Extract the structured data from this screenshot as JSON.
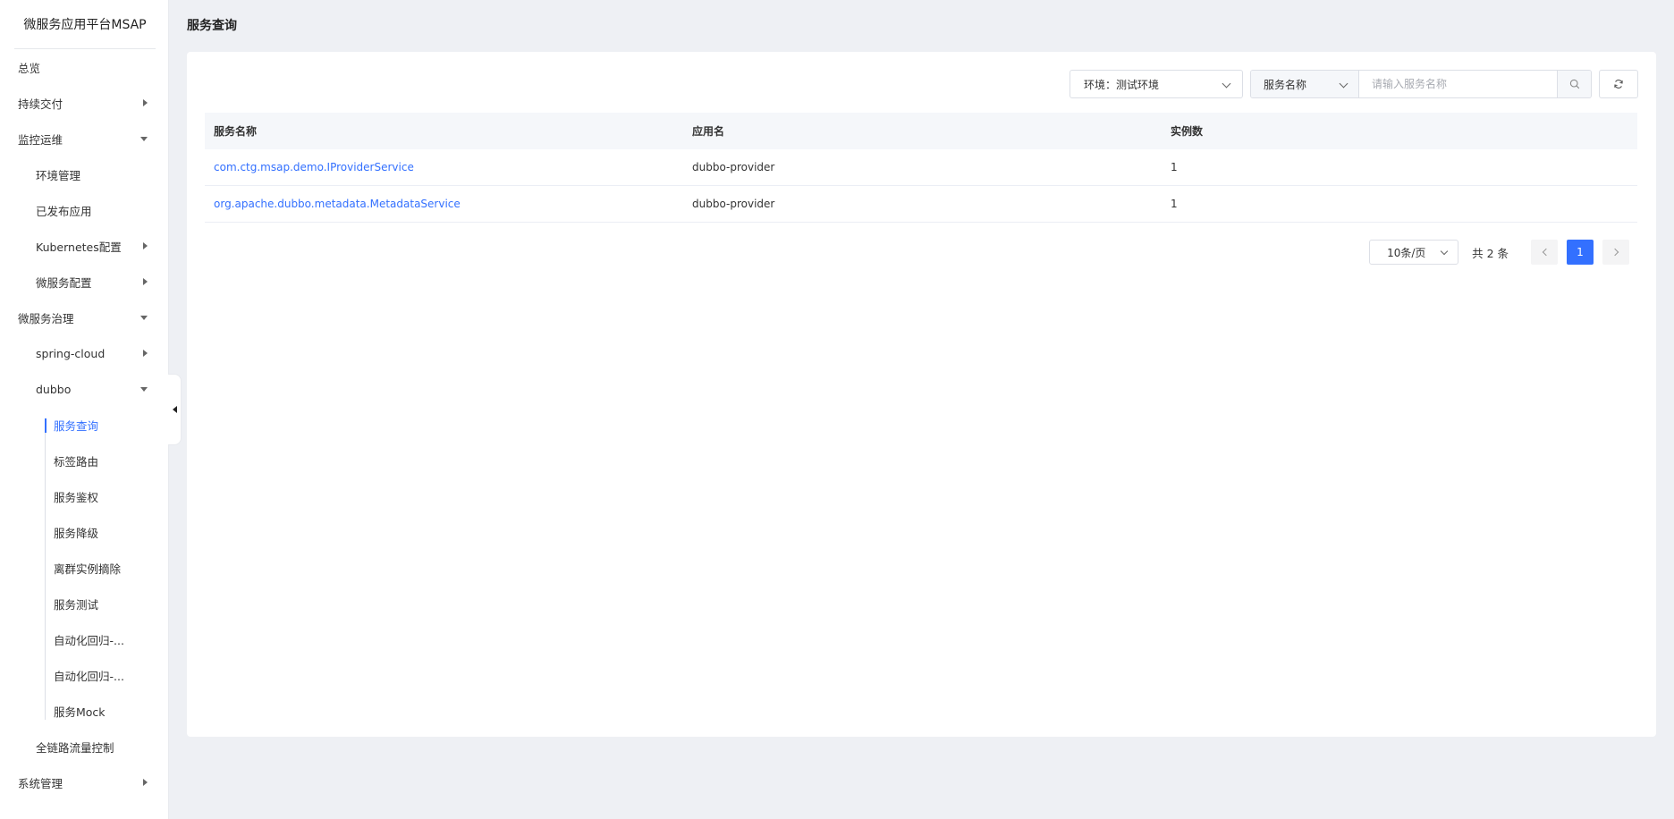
{
  "sidebar": {
    "brand": "微服务应用平台MSAP",
    "items": [
      {
        "label": "总览"
      },
      {
        "label": "持续交付"
      },
      {
        "label": "监控运维"
      },
      {
        "label": "环境管理"
      },
      {
        "label": "已发布应用"
      },
      {
        "label": "Kubernetes配置"
      },
      {
        "label": "微服务配置"
      },
      {
        "label": "微服务治理"
      },
      {
        "label": "spring-cloud"
      },
      {
        "label": "dubbo"
      },
      {
        "label": "服务查询"
      },
      {
        "label": "标签路由"
      },
      {
        "label": "服务鉴权"
      },
      {
        "label": "服务降级"
      },
      {
        "label": "离群实例摘除"
      },
      {
        "label": "服务测试"
      },
      {
        "label": "自动化回归-..."
      },
      {
        "label": "自动化回归-..."
      },
      {
        "label": "服务Mock"
      },
      {
        "label": "全链路流量控制"
      },
      {
        "label": "系统管理"
      }
    ]
  },
  "header": {
    "title": "服务查询"
  },
  "toolbar": {
    "env_select": "环境：测试环境",
    "search_type": "服务名称",
    "search_placeholder": "请输入服务名称"
  },
  "table": {
    "headers": [
      "服务名称",
      "应用名",
      "实例数"
    ],
    "rows": [
      [
        "com.ctg.msap.demo.IProviderService",
        "dubbo-provider",
        "1"
      ],
      [
        "org.apache.dubbo.metadata.MetadataService",
        "dubbo-provider",
        "1"
      ]
    ]
  },
  "pagination": {
    "page_size": "10条/页",
    "total": "共 2 条",
    "current_page": "1"
  },
  "colors": {
    "accent": "#3370ff",
    "background": "#eef0f4"
  }
}
